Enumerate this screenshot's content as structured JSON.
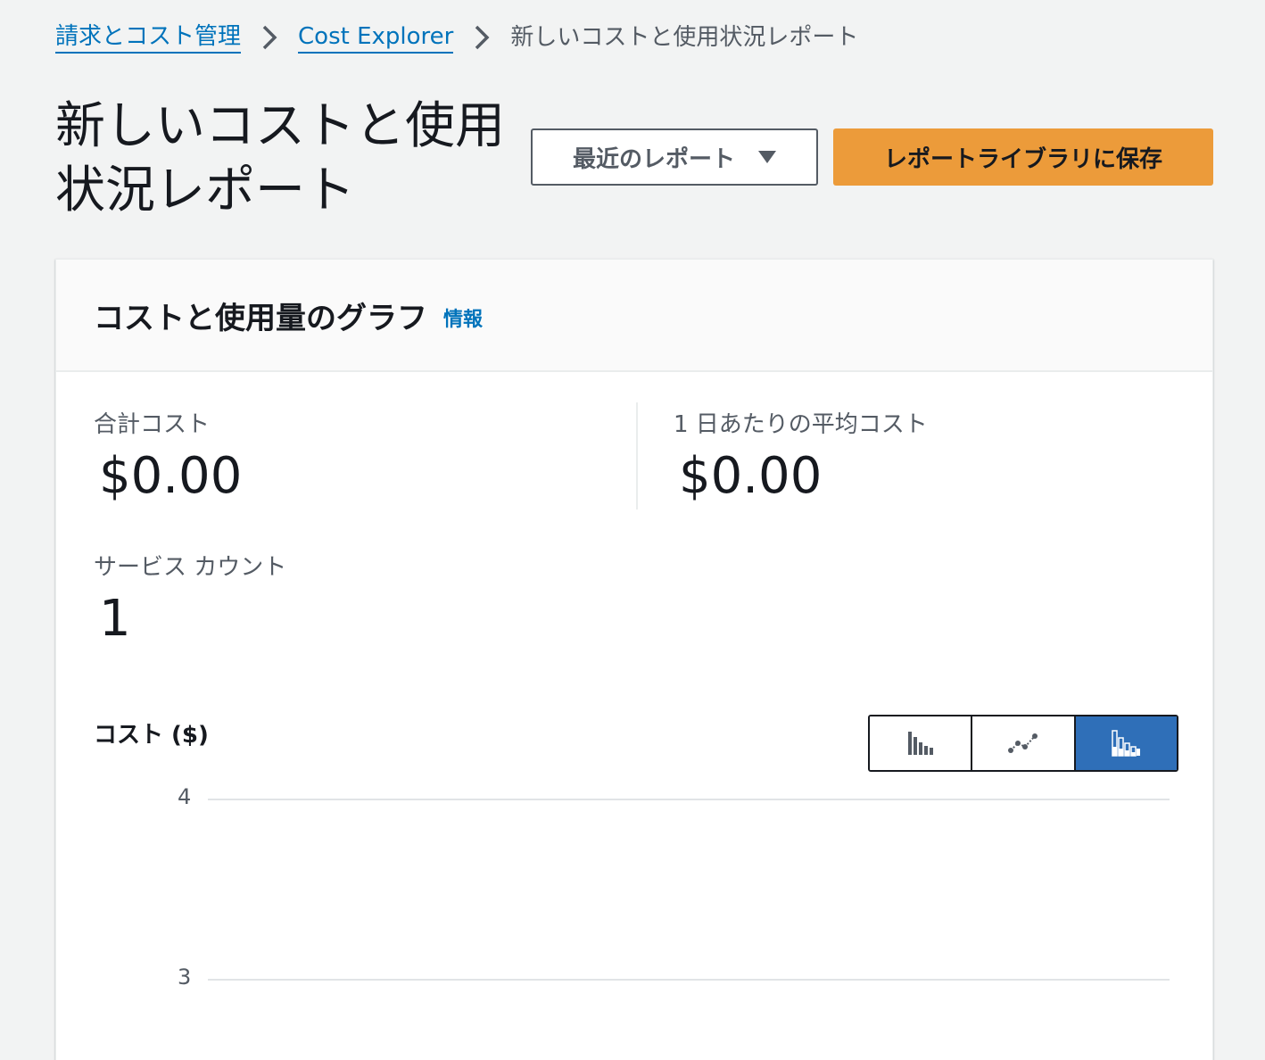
{
  "breadcrumb": {
    "items": [
      {
        "label": "請求とコスト管理"
      },
      {
        "label": "Cost Explorer"
      }
    ],
    "current": "新しいコストと使用状況レポート"
  },
  "header": {
    "title": "新しいコストと使用状況レポート",
    "recent_reports_label": "最近のレポート",
    "save_label": "レポートライブラリに保存"
  },
  "panel": {
    "title": "コストと使用量のグラフ",
    "info_label": "情報",
    "metrics": {
      "total_cost_label": "合計コスト",
      "total_cost_value": "$0.00",
      "daily_avg_label": "1 日あたりの平均コスト",
      "daily_avg_value": "$0.00",
      "service_count_label": "サービス カウント",
      "service_count_value": "1"
    },
    "chart_label": "コスト ($)",
    "chart_types": [
      {
        "icon": "bar-chart-icon",
        "active": false
      },
      {
        "icon": "line-chart-icon",
        "active": false
      },
      {
        "icon": "stacked-bar-chart-icon",
        "active": true
      }
    ]
  },
  "colors": {
    "accent": "#0073bb",
    "primary_button": "#ec9b3a",
    "active_toggle": "#2f6fb8"
  },
  "chart_data": {
    "type": "bar",
    "title": "",
    "ylabel": "コスト ($)",
    "yticks": [
      "4",
      "3"
    ],
    "ylim": [
      3,
      4
    ],
    "series": [],
    "grid": true
  }
}
